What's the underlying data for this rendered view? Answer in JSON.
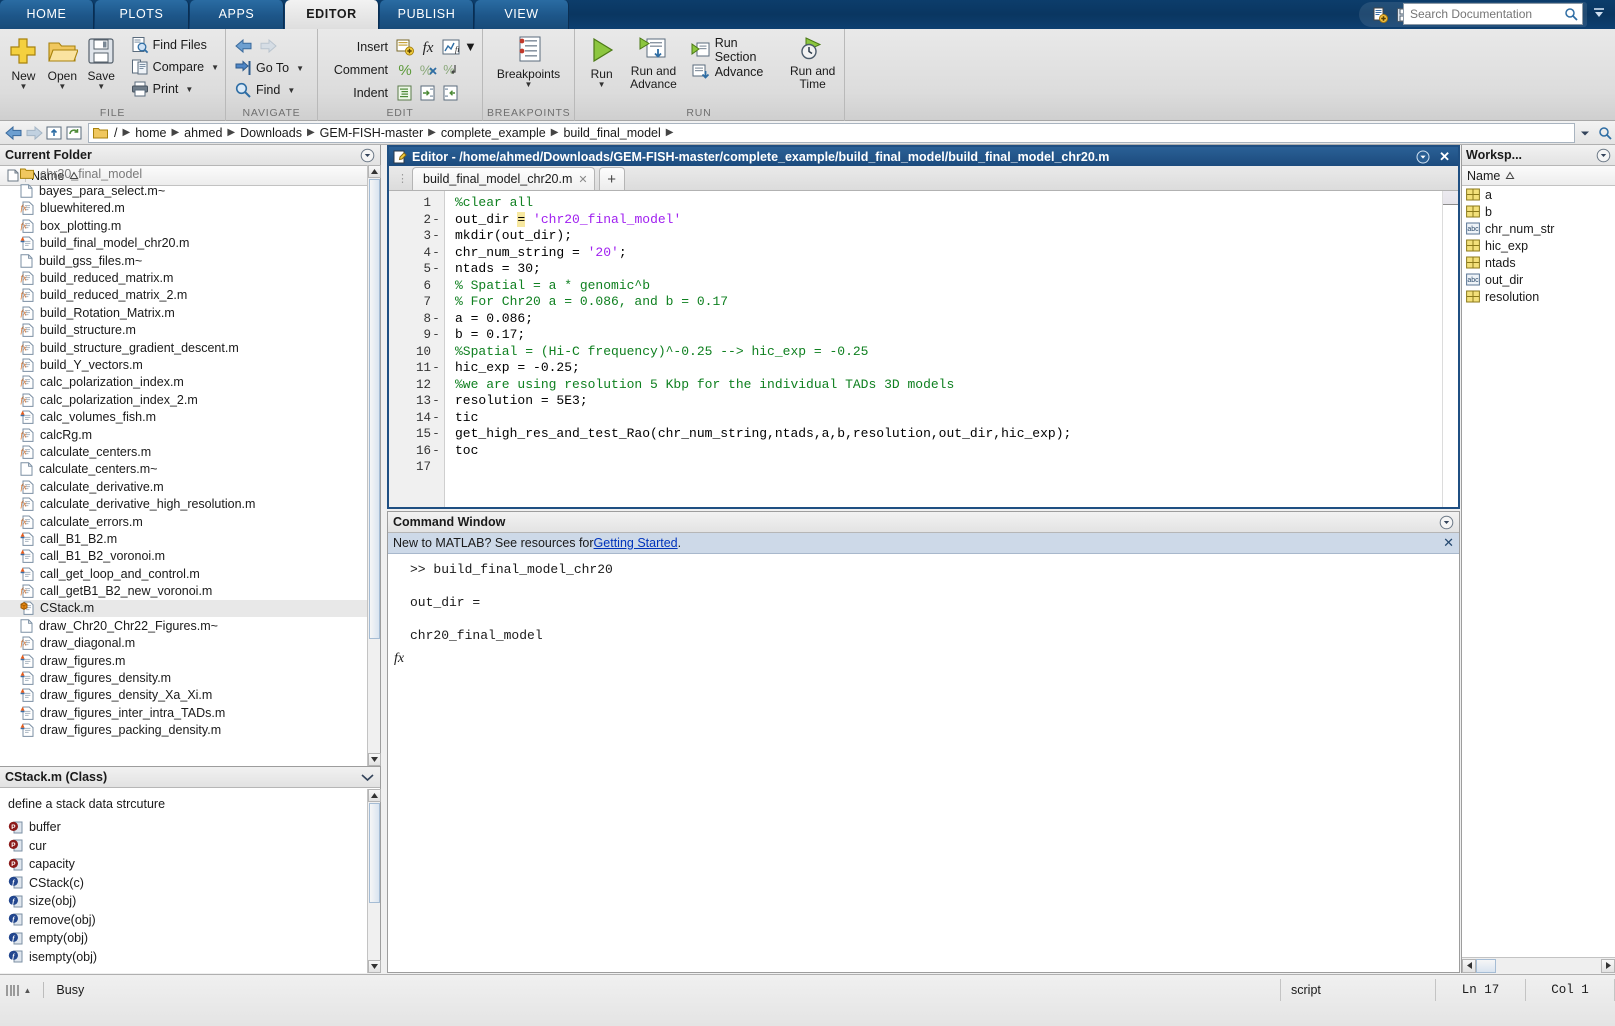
{
  "ribbon": {
    "tabs": [
      {
        "label": "HOME",
        "active": false
      },
      {
        "label": "PLOTS",
        "active": false
      },
      {
        "label": "APPS",
        "active": false
      },
      {
        "label": "EDITOR",
        "active": true
      },
      {
        "label": "PUBLISH",
        "active": false
      },
      {
        "label": "VIEW",
        "active": false
      }
    ],
    "groups": {
      "file": {
        "name": "FILE",
        "new": "New",
        "open": "Open",
        "save": "Save",
        "find_files": "Find Files",
        "compare": "Compare",
        "print": "Print"
      },
      "navigate": {
        "name": "NAVIGATE",
        "go_to": "Go To",
        "find": "Find"
      },
      "edit": {
        "name": "EDIT",
        "insert": "Insert",
        "comment": "Comment",
        "indent": "Indent"
      },
      "breakpoints": {
        "name": "BREAKPOINTS",
        "label": "Breakpoints"
      },
      "run": {
        "name": "RUN",
        "run": "Run",
        "run_and_advance": "Run and\nAdvance",
        "run_section": "Run Section",
        "advance": "Advance",
        "run_and_time": "Run and\nTime"
      }
    }
  },
  "search": {
    "placeholder": "Search Documentation"
  },
  "path": {
    "root": "/",
    "crumbs": [
      "home",
      "ahmed",
      "Downloads",
      "GEM-FISH-master",
      "complete_example",
      "build_final_model"
    ]
  },
  "current_folder": {
    "title": "Current Folder",
    "column_name": "Name",
    "files": [
      {
        "name": "chr20_final_model",
        "icon": "folder-icon",
        "type": "folder"
      },
      {
        "name": "bayes_para_select.m~",
        "icon": "plain-file-icon",
        "type": "backup"
      },
      {
        "name": "bluewhitered.m",
        "icon": "function-file-icon",
        "type": "function"
      },
      {
        "name": "box_plotting.m",
        "icon": "function-file-icon",
        "type": "function"
      },
      {
        "name": "build_final_model_chr20.m",
        "icon": "script-file-icon",
        "type": "script"
      },
      {
        "name": "build_gss_files.m~",
        "icon": "plain-file-icon",
        "type": "backup"
      },
      {
        "name": "build_reduced_matrix.m",
        "icon": "function-file-icon",
        "type": "function"
      },
      {
        "name": "build_reduced_matrix_2.m",
        "icon": "function-file-icon",
        "type": "function"
      },
      {
        "name": "build_Rotation_Matrix.m",
        "icon": "function-file-icon",
        "type": "function"
      },
      {
        "name": "build_structure.m",
        "icon": "function-file-icon",
        "type": "function"
      },
      {
        "name": "build_structure_gradient_descent.m",
        "icon": "function-file-icon",
        "type": "function"
      },
      {
        "name": "build_Y_vectors.m",
        "icon": "function-file-icon",
        "type": "function"
      },
      {
        "name": "calc_polarization_index.m",
        "icon": "function-file-icon",
        "type": "function"
      },
      {
        "name": "calc_polarization_index_2.m",
        "icon": "function-file-icon",
        "type": "function"
      },
      {
        "name": "calc_volumes_fish.m",
        "icon": "script-file-icon",
        "type": "script"
      },
      {
        "name": "calcRg.m",
        "icon": "function-file-icon",
        "type": "function"
      },
      {
        "name": "calculate_centers.m",
        "icon": "function-file-icon",
        "type": "function"
      },
      {
        "name": "calculate_centers.m~",
        "icon": "plain-file-icon",
        "type": "backup"
      },
      {
        "name": "calculate_derivative.m",
        "icon": "function-file-icon",
        "type": "function"
      },
      {
        "name": "calculate_derivative_high_resolution.m",
        "icon": "function-file-icon",
        "type": "function"
      },
      {
        "name": "calculate_errors.m",
        "icon": "function-file-icon",
        "type": "function"
      },
      {
        "name": "call_B1_B2.m",
        "icon": "script-file-icon",
        "type": "script"
      },
      {
        "name": "call_B1_B2_voronoi.m",
        "icon": "script-file-icon",
        "type": "script"
      },
      {
        "name": "call_get_loop_and_control.m",
        "icon": "script-file-icon",
        "type": "script"
      },
      {
        "name": "call_getB1_B2_new_voronoi.m",
        "icon": "function-file-icon",
        "type": "function"
      },
      {
        "name": "CStack.m",
        "icon": "class-file-icon",
        "type": "class",
        "selected": true
      },
      {
        "name": "draw_Chr20_Chr22_Figures.m~",
        "icon": "plain-file-icon",
        "type": "backup"
      },
      {
        "name": "draw_diagonal.m",
        "icon": "function-file-icon",
        "type": "function"
      },
      {
        "name": "draw_figures.m",
        "icon": "script-file-icon",
        "type": "script"
      },
      {
        "name": "draw_figures_density.m",
        "icon": "script-file-icon",
        "type": "script"
      },
      {
        "name": "draw_figures_density_Xa_Xi.m",
        "icon": "script-file-icon",
        "type": "script"
      },
      {
        "name": "draw_figures_inter_intra_TADs.m",
        "icon": "script-file-icon",
        "type": "script"
      },
      {
        "name": "draw_figures_packing_density.m",
        "icon": "script-file-icon",
        "type": "script"
      }
    ]
  },
  "details": {
    "title": "CStack.m  (Class)",
    "description": "define a stack data strcuture",
    "members": [
      {
        "name": "buffer",
        "kind": "property"
      },
      {
        "name": "cur",
        "kind": "property"
      },
      {
        "name": "capacity",
        "kind": "property"
      },
      {
        "name": "CStack(c)",
        "kind": "method"
      },
      {
        "name": "size(obj)",
        "kind": "method"
      },
      {
        "name": "remove(obj)",
        "kind": "method"
      },
      {
        "name": "empty(obj)",
        "kind": "method"
      },
      {
        "name": "isempty(obj)",
        "kind": "method"
      }
    ]
  },
  "editor": {
    "title": "Editor - /home/ahmed/Downloads/GEM-FISH-master/complete_example/build_final_model/build_final_model_chr20.m",
    "tab_label": "build_final_model_chr20.m",
    "new_tab_label": "+",
    "lines": [
      {
        "n": "1",
        "bp": "",
        "text": "%clear all",
        "style": "comment"
      },
      {
        "n": "2",
        "bp": "-",
        "text": "out_dir = 'chr20_final_model'",
        "style": "assign_string_hl"
      },
      {
        "n": "3",
        "bp": "-",
        "text": "mkdir(out_dir);",
        "style": "code"
      },
      {
        "n": "4",
        "bp": "-",
        "text": "chr_num_string = '20';",
        "style": "code_string"
      },
      {
        "n": "5",
        "bp": "-",
        "text": "ntads = 30;",
        "style": "code"
      },
      {
        "n": "6",
        "bp": "",
        "text": "% Spatial = a * genomic^b",
        "style": "comment"
      },
      {
        "n": "7",
        "bp": "",
        "text": "% For Chr20 a = 0.086, and b = 0.17",
        "style": "comment"
      },
      {
        "n": "8",
        "bp": "-",
        "text": "a = 0.086;",
        "style": "code"
      },
      {
        "n": "9",
        "bp": "-",
        "text": "b = 0.17;",
        "style": "code"
      },
      {
        "n": "10",
        "bp": "",
        "text": "%Spatial = (Hi-C frequency)^-0.25 --> hic_exp = -0.25",
        "style": "comment"
      },
      {
        "n": "11",
        "bp": "-",
        "text": "hic_exp = -0.25;",
        "style": "code"
      },
      {
        "n": "12",
        "bp": "",
        "text": "%we are using resolution 5 Kbp for the individual TADs 3D models",
        "style": "comment"
      },
      {
        "n": "13",
        "bp": "-",
        "text": "resolution = 5E3;",
        "style": "code"
      },
      {
        "n": "14",
        "bp": "-",
        "text": "tic",
        "style": "code"
      },
      {
        "n": "15",
        "bp": "-",
        "text": "get_high_res_and_test_Rao(chr_num_string,ntads,a,b,resolution,out_dir,hic_exp);",
        "style": "code"
      },
      {
        "n": "16",
        "bp": "-",
        "text": "toc",
        "style": "code"
      },
      {
        "n": "17",
        "bp": "",
        "text": "",
        "style": "code"
      }
    ]
  },
  "command_window": {
    "title": "Command Window",
    "banner_prefix": "New to MATLAB? See resources for ",
    "banner_link": "Getting Started",
    "banner_suffix": ".",
    "lines": [
      ">> build_final_model_chr20",
      "",
      "out_dir =",
      "",
      "chr20_final_model"
    ],
    "fx_glyph": "fx"
  },
  "workspace": {
    "title": "Worksp...",
    "column_name": "Name",
    "variables": [
      {
        "name": "a",
        "icon": "matrix-icon"
      },
      {
        "name": "b",
        "icon": "matrix-icon"
      },
      {
        "name": "chr_num_str",
        "icon": "string-icon"
      },
      {
        "name": "hic_exp",
        "icon": "matrix-icon"
      },
      {
        "name": "ntads",
        "icon": "matrix-icon"
      },
      {
        "name": "out_dir",
        "icon": "string-icon"
      },
      {
        "name": "resolution",
        "icon": "matrix-icon"
      }
    ]
  },
  "status_bar": {
    "busy": "Busy",
    "file_type": "script",
    "line": "Ln 17",
    "column": "Col 1"
  },
  "colors": {
    "ribbon_blue": "#1d5689",
    "title_blue": "#1f4f82",
    "comment_green": "#0f8020",
    "string_purple": "#a020f0",
    "banner_blue": "#cdd9e8",
    "link_blue": "#0033bb",
    "selection_gray": "#e8e8e8"
  }
}
